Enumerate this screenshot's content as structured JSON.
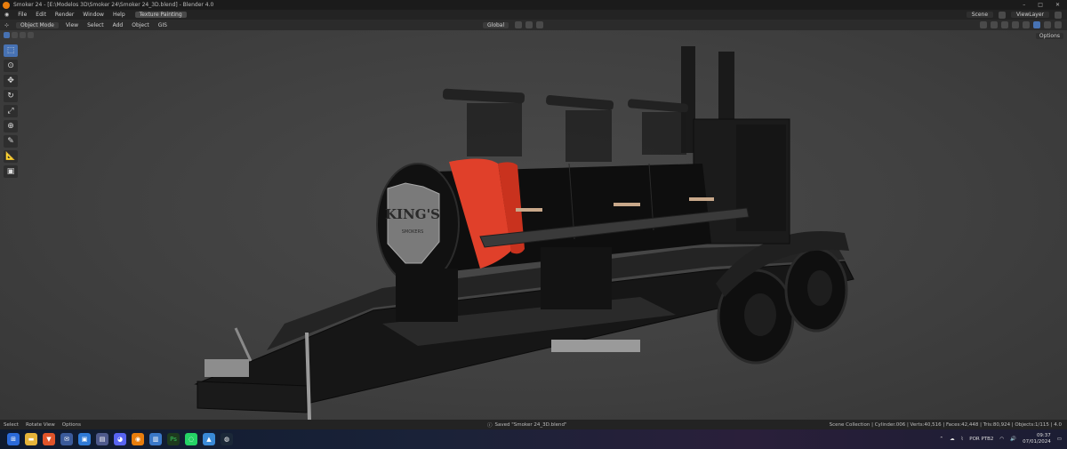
{
  "window": {
    "title": "Smoker 24 - [E:\\Modelos 3D\\Smoker 24\\Smoker 24_3D.blend] - Blender 4.0"
  },
  "menubar": {
    "items": [
      "File",
      "Edit",
      "Render",
      "Window",
      "Help"
    ],
    "workspace_tab": "Texture Painting",
    "scene_label": "Scene",
    "viewlayer_label": "ViewLayer"
  },
  "header": {
    "mode": "Object Mode",
    "menu": [
      "View",
      "Select",
      "Add",
      "Object",
      "GIS"
    ],
    "orientation": "Global"
  },
  "viewport": {
    "options_label": "Options",
    "badge_line1": "KING'S",
    "badge_line2": "SMOKERS"
  },
  "status": {
    "left_items": [
      "Select",
      "Rotate View",
      "Options"
    ],
    "message": "Saved \"Smoker 24_3D.blend\"",
    "stats": "Scene Collection | Cylinder.006 | Verts:40,516 | Faces:42,448 | Tris:80,924 | Objects:1/115 | 4.0"
  },
  "taskbar": {
    "language": "POR PTB2",
    "time": "09:37",
    "date": "07/01/2024"
  },
  "colors": {
    "accent": "#4772b3",
    "blender_orange": "#e87d0d",
    "smoker_stripe": "#e0402a"
  }
}
